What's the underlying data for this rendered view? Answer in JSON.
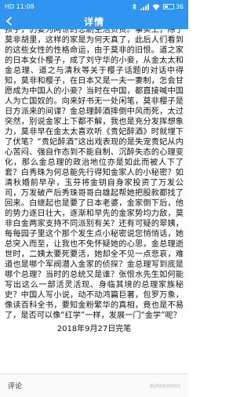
{
  "status_bar": {
    "left_text": "HD 11:08",
    "battery_percent": 36,
    "battery_text": "36"
  },
  "nav": {
    "title": "详情"
  },
  "article": {
    "body": "孩子，仍要为两世的悲剧生活负责。事实上，除了莫非胡里，这样的家是为何天真了，此后人们看到的这些女性的性格命运，由于莫非的旧恨。道之家的日本女仆樱子，成了刘守华的小妾，从金太太和金总理、道之与清秋等关于樱子话题的对话中得知，莫非和樱子，在日本又是一夫一妻制，怎会甘愿成为中国人的小妾？当时在中国，都直接喊中国人为亡国奴的。向来好书无一处闲笔，莫非樱子是日方派来的间谍？金总理醉酒摔倒中风而死，太过突然，别说金家上下都不解，我也是充分发挥想象力，莫非早在金太太喜欢听《贵妃醉酒》时就埋下了伏笔？“贵妃醉酒”这出戏表现的是失宠贵妃从内心苦闷、强自作态到不能自制、沉醉失态的心理变化，那么金总理的政治地位亦是如此而被人下了套？白秀珠为何总能先行得知金家人的小秘密？如清秋婚前早孕，玉芬将金钥自身家投资了万发公司，万发破产后秀珠哥哥白雄起帮她把股款都找了回来。白继起也是要了日本老婆，金家倒下后，他的势力逐日壮大，逐渐和早先的金家势均力敌，莫非白金两家支持不同派别有关？还有可疑的翠姨，每每园子里这个那个发生点小秘密说您悄悄话，她总突入而至，让我也不免怀疑她的心思，金总理逝世时，二姨太要死要活，她却全不见一点悲哀，难道也是哪个军阀潜入金家的侦探？金总理写到底是哪个总理？当时的总统又是谁？张恨水先生如何能写出这么一部活灵活现、身临其境的总理家族秘史？中国人写小说，动不动鸿篇巨著，包罗万象，像读百科全书，要知金粉繁华的真相，竟也是不易了，是否可以像“红学”一样，发展一门“金学”呢？",
    "end_line": "2018年9月27日完笔"
  },
  "footer": {
    "comment_label": "评论",
    "watermark": "Bytesisters"
  },
  "colors": {
    "accent": "#2f95f0"
  }
}
